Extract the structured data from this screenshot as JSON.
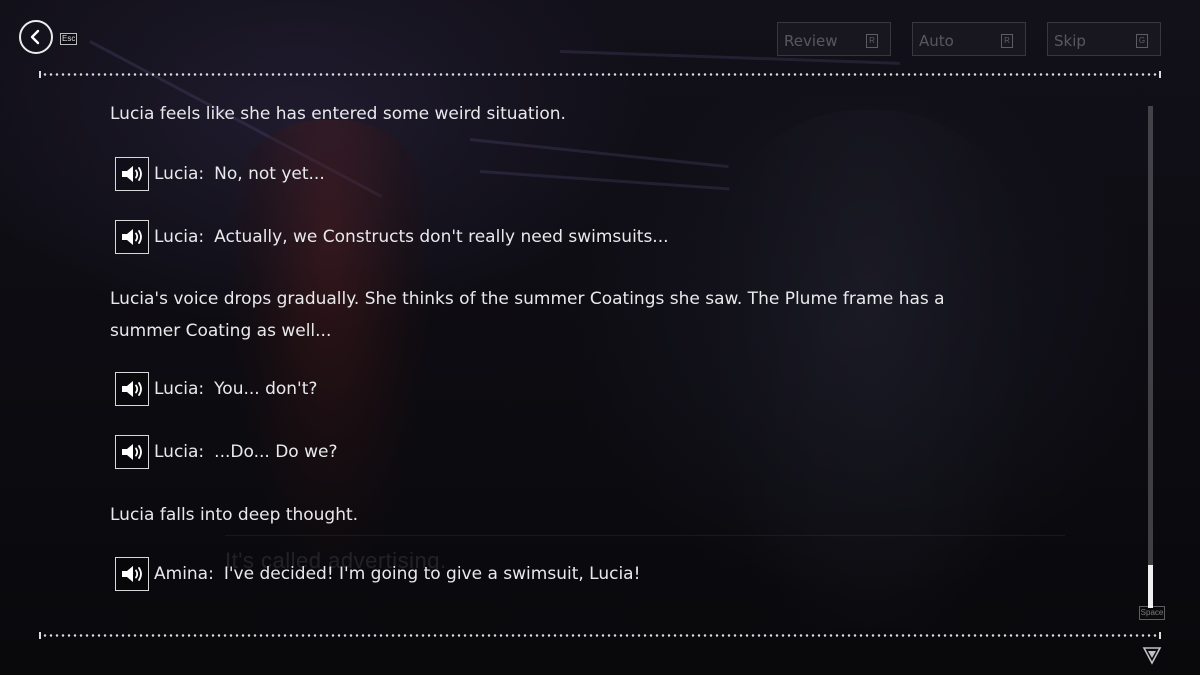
{
  "header": {
    "back_key": "Esc",
    "controls": [
      {
        "label": "Review",
        "key": "R"
      },
      {
        "label": "Auto",
        "key": "R"
      },
      {
        "label": "Skip",
        "key": "G"
      }
    ]
  },
  "background_caption": "It's called advertising.",
  "log": [
    {
      "type": "narration",
      "text": "Lucia feels like she has entered some weird situation."
    },
    {
      "type": "dialogue",
      "speaker": "Lucia:",
      "text": "No, not yet...",
      "icon": "speaker-icon"
    },
    {
      "type": "dialogue",
      "speaker": "Lucia:",
      "text": "Actually, we Constructs don't really need swimsuits...",
      "icon": "speaker-icon"
    },
    {
      "type": "narration",
      "text": "Lucia's voice drops gradually. She thinks of the summer Coatings she saw. The Plume frame has a summer Coating as well..."
    },
    {
      "type": "dialogue",
      "speaker": "Lucia:",
      "text": "You... don't?",
      "icon": "speaker-icon"
    },
    {
      "type": "dialogue",
      "speaker": "Lucia:",
      "text": "...Do... Do we?",
      "icon": "speaker-icon"
    },
    {
      "type": "narration",
      "text": "Lucia falls into deep thought."
    },
    {
      "type": "dialogue",
      "speaker": "Amina:",
      "text": "I've decided! I'm going to give a swimsuit, Lucia!",
      "icon": "speaker-icon"
    }
  ],
  "scroll_key": "Space",
  "scroll_position": 1.0
}
